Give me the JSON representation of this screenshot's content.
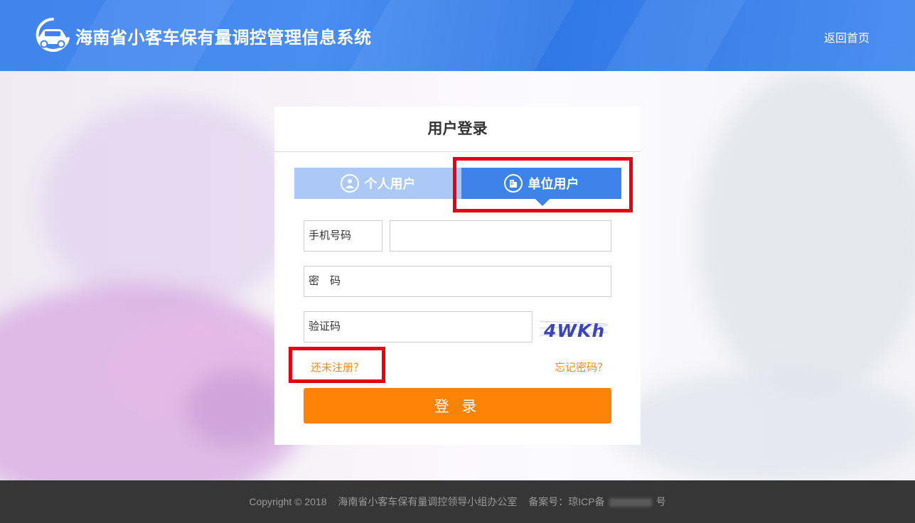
{
  "header": {
    "title": "海南省小客车保有量调控管理信息系统",
    "home_link": "返回首页",
    "logo_icon": "car-logo-icon",
    "bg_color": "#3f83ec"
  },
  "login": {
    "title": "用户登录",
    "tabs": [
      {
        "label": "个人用户",
        "icon": "user-icon",
        "active": false
      },
      {
        "label": "单位用户",
        "icon": "building-icon",
        "active": true
      }
    ],
    "phone_label": "手机号码",
    "password_label": "密　码",
    "captcha_label": "验证码",
    "captcha_text": "4WKh",
    "register_link": "还未注册？",
    "forgot_link": "忘记密码？",
    "login_button": "登 录",
    "accent_color": "#fd8306",
    "tab_active_color": "#3e83ec",
    "tab_inactive_color": "#abc9f4"
  },
  "footer": {
    "copyright": "Copyright  © 2018",
    "org": "海南省小客车保有量调控领导小组办公室",
    "icp_prefix": "备案号：琼ICP备",
    "icp_suffix": "号"
  }
}
